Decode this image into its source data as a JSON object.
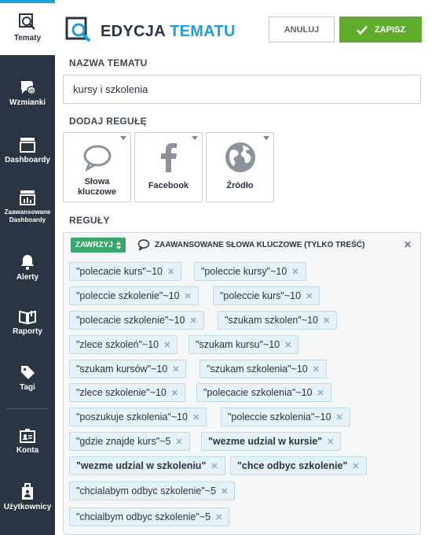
{
  "sidebar": {
    "items": [
      {
        "label": "Tematy",
        "icon": "topics-icon"
      },
      {
        "label": "Wzmianki",
        "icon": "mentions-icon"
      },
      {
        "label": "Dashboardy",
        "icon": "dashboard-icon"
      },
      {
        "label": "Zaawansowane Dashboardy",
        "icon": "advanced-dashboard-icon"
      },
      {
        "label": "Alerty",
        "icon": "bell-icon"
      },
      {
        "label": "Raporty",
        "icon": "report-icon"
      },
      {
        "label": "Tagi",
        "icon": "tag-icon"
      },
      {
        "label": "Konta",
        "icon": "account-icon"
      },
      {
        "label": "Użytkownicy",
        "icon": "users-icon"
      }
    ]
  },
  "header": {
    "title_part1": "EDYCJA",
    "title_part2": "TEMATU",
    "cancel_label": "ANULUJ",
    "save_label": "ZAPISZ"
  },
  "topic": {
    "label": "NAZWA TEMATU",
    "value": "kursy i szkolenia"
  },
  "add_rule": {
    "label": "DODAJ REGUŁĘ",
    "cards": [
      {
        "label_line1": "Słowa",
        "label_line2": "kluczowe"
      },
      {
        "label_line1": "Facebook"
      },
      {
        "label_line1": "Źródło"
      }
    ]
  },
  "rules": {
    "label": "REGUŁY",
    "operator": "ZAWRZYJ",
    "type_label": "ZAAWANSOWANE SŁOWA KLUCZOWE (TYLKO TREŚĆ)",
    "tags": [
      "\"polecacie kurs\"~10",
      "\"poleccie kursy\"~10",
      "\"poleccie szkolenie\"~10",
      "\"poleccie kurs\"~10",
      "\"polecacie szkolenie\"~10",
      "\"szukam szkolen\"~10",
      "\"zlece szkoleń\"~10",
      "\"szukam kursu\"~10",
      "\"szukam kursów\"~10",
      "\"szukam szkolenia\"~10",
      "\"zlece szkolenie\"~10",
      "\"polecacie szkolenia\"~10",
      "\"poszukuje szkolenia\"~10",
      "\"poleccie szkolenia\"~10",
      "\"gdzie znajde kurs\"~5",
      "\"wezme udzial w kursie\"",
      "\"wezme udzial w szkoleniu\"",
      "\"chce odbyc szkolenie\"",
      "\"chcialabym odbyc szkolenie\"~5",
      "\"chcialbym odbyc szkolenie\"~5"
    ]
  },
  "colors": {
    "sidebar_bg": "#2b3442",
    "accent": "#1e9fda",
    "save_green": "#5fab2b",
    "contains_green": "#3aa76d"
  }
}
